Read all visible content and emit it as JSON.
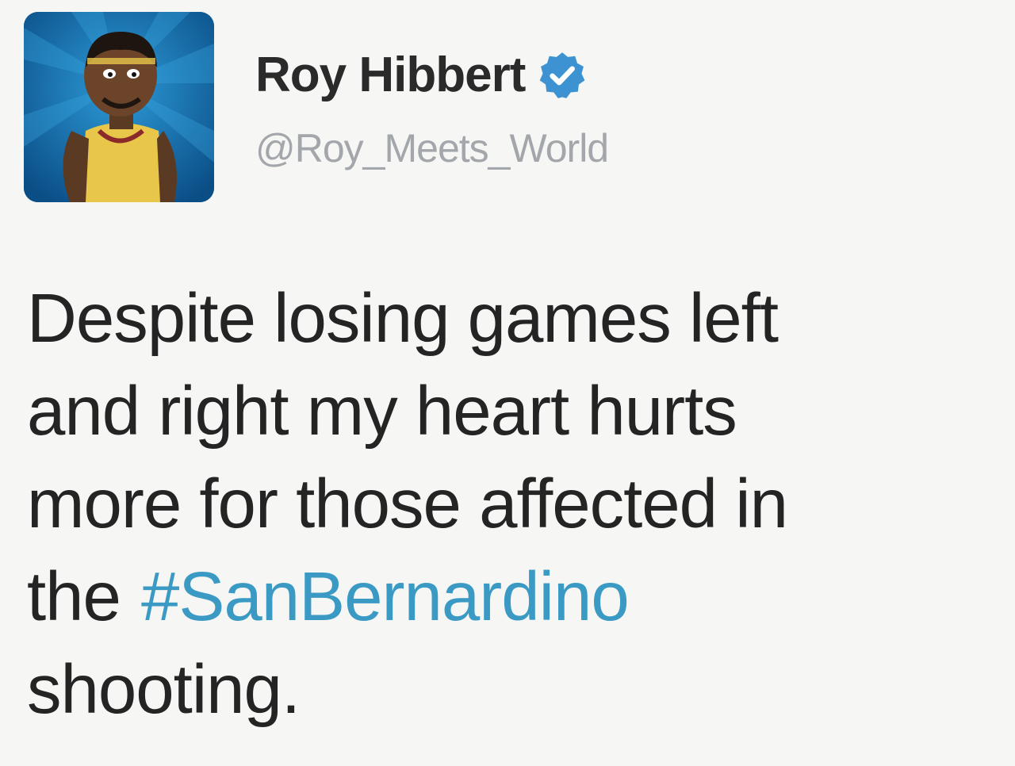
{
  "user": {
    "display_name": "Roy Hibbert",
    "handle": "@Roy_Meets_World",
    "avatar_icon": "cartoon-basketball-player-avatar",
    "verified_icon": "verified-badge-icon"
  },
  "tweet": {
    "line1": "Despite losing games left",
    "line2": "and right my heart hurts",
    "line3": "more for those affected in",
    "line4_prefix": "the",
    "hashtag": "#SanBernardino",
    "line5": "shooting."
  },
  "colors": {
    "hashtag": "#3a9ac4",
    "verified": "#3d93d1",
    "handle": "#a3a6aa",
    "text": "#242424"
  }
}
